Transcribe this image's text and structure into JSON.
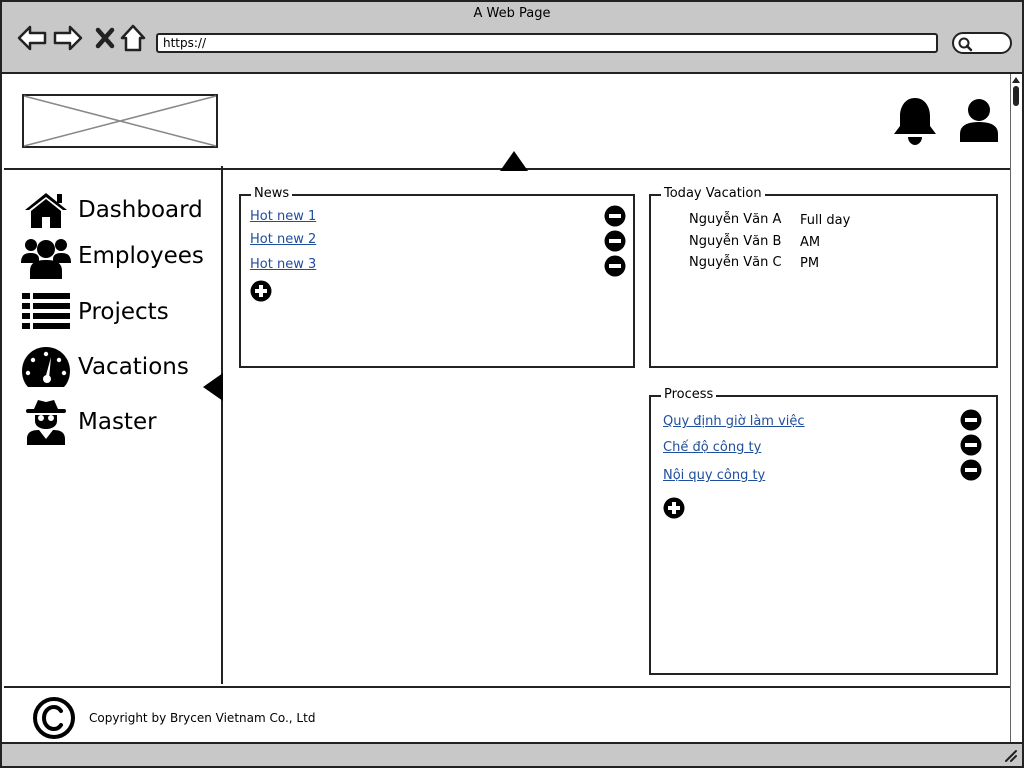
{
  "window": {
    "title": "A Web Page"
  },
  "browser": {
    "url": "https://"
  },
  "sidebar": {
    "items": [
      {
        "label": "Dashboard",
        "icon": "home-icon"
      },
      {
        "label": "Employees",
        "icon": "users-icon"
      },
      {
        "label": "Projects",
        "icon": "list-icon"
      },
      {
        "label": "Vacations",
        "icon": "dashboard-gauge-icon"
      },
      {
        "label": "Master",
        "icon": "spy-icon"
      }
    ]
  },
  "news": {
    "title": "News",
    "items": [
      "Hot new 1",
      "Hot new 2",
      "Hot new 3"
    ]
  },
  "vacation": {
    "title": "Today Vacation",
    "rows": [
      {
        "name": "Nguyễn Văn A",
        "type": "Full day"
      },
      {
        "name": "Nguyễn Văn B",
        "type": "AM"
      },
      {
        "name": "Nguyễn Văn C",
        "type": "PM"
      }
    ]
  },
  "process": {
    "title": "Process",
    "items": [
      "Quy định giờ làm việc",
      "Chế độ công ty",
      "Nội quy công ty"
    ]
  },
  "footer": {
    "copyright": "Copyright by Brycen Vietnam Co., Ltd"
  }
}
